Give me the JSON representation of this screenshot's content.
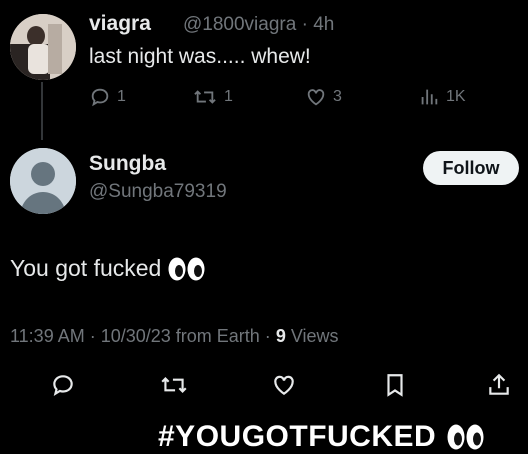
{
  "parent_tweet": {
    "display_name": "viagra",
    "handle_time": "@1800viagra · 4h",
    "text": "last night was..... whew!",
    "stats": {
      "replies": "1",
      "retweets": "1",
      "likes": "3",
      "views": "1K"
    }
  },
  "reply_tweet": {
    "display_name": "Sungba",
    "handle": "@Sungba79319",
    "follow_label": "Follow",
    "text": "You got fucked",
    "meta": {
      "timestamp": "11:39 AM · 10/30/23 from Earth · ",
      "views_count": "9",
      "views_label": " Views"
    }
  },
  "caption": {
    "text": "#YOUGOTFUCKED"
  },
  "icons": {
    "reply": "reply-icon",
    "retweet": "retweet-icon",
    "like": "heart-icon",
    "views": "analytics-icon",
    "bookmark": "bookmark-icon",
    "share": "share-icon",
    "eyes": "eyes-emoji"
  },
  "colors": {
    "background": "#000000",
    "text": "#e7e9ea",
    "muted": "#71767b",
    "follow_bg": "#eff3f4"
  }
}
